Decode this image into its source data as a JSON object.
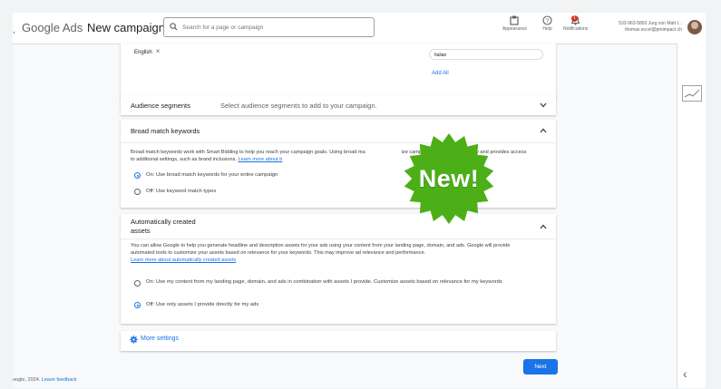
{
  "header": {
    "brand": "Google Ads",
    "page_title": "New campaign",
    "search_placeholder": "Search for a page or campaign",
    "appearance_label": "Appearance",
    "help_label": "Help",
    "notifications_label": "Notifications",
    "notifications_count": "1",
    "account_line1": "533-963-5850 Jurg von Matt I...",
    "account_line2": "thomas.eccel@pmimpact.ch"
  },
  "language": {
    "selected_chip": "English",
    "option_chip": "Italian",
    "add_all": "Add All"
  },
  "audience": {
    "title": "Audience segments",
    "subtitle": "Select audience segments to add to your campaign."
  },
  "broad_match": {
    "title": "Broad match keywords",
    "desc_part1": "Broad match keywords work with Smart Bidding to help you reach your campaign goals. Using broad ma",
    "desc_part2": "ize campaign ensures consistency and provides access to additional settings, such as brand inclusions.",
    "learn_more": "Learn more about b",
    "option_on": "On: Use broad match keywords for your entire campaign",
    "option_off": "Off: Use keyword match types",
    "selected": "on"
  },
  "badge": {
    "text": "New!",
    "color": "#4caf18"
  },
  "auto_assets": {
    "title_line1": "Automatically created",
    "title_line2": "assets",
    "desc": "You can allow Google to help you generate headline and description assets for your ads using your content from your landing page, domain, and ads. Google will provide automated tools to customize your assets based on relevance for your keywords. This may improve ad relevance and performance.",
    "learn_more": "Learn more about automatically created assets",
    "option_on": "On: Use my content from my landing page, domain, and ads in combination with assets I provide. Customize assets based on relevance for my keywords",
    "option_off": "Off: Use only assets I provide directly for my ads",
    "selected": "off"
  },
  "more_settings": "More settings",
  "next_label": "Next",
  "footer": {
    "copyright": "oogle, 2024.",
    "feedback": "Leave feedback"
  },
  "colors": {
    "accent": "#1a73e8",
    "background": "#f8f9fa"
  }
}
